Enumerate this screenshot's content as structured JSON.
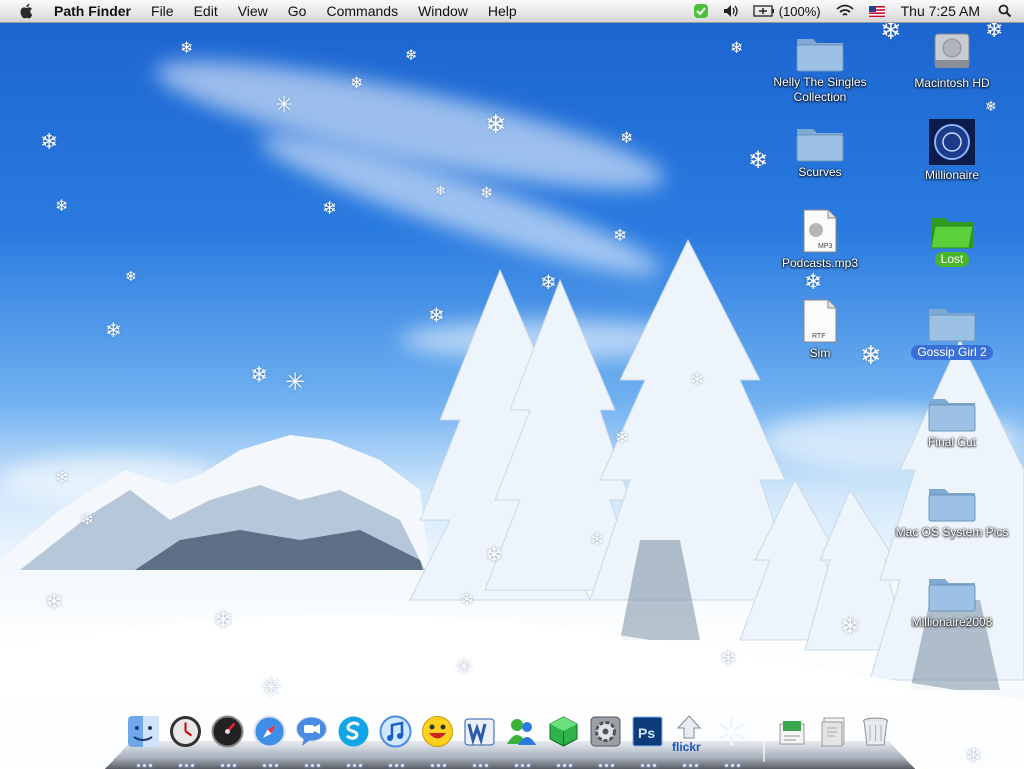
{
  "menubar": {
    "apple_icon": "apple-logo",
    "app_name": "Path Finder",
    "items": [
      "File",
      "Edit",
      "View",
      "Go",
      "Commands",
      "Window",
      "Help"
    ],
    "tray": {
      "battery": "(100%)",
      "clock": "Thu 7:25 AM",
      "icons": [
        "status-check-icon",
        "volume-icon",
        "battery-icon",
        "wifi-icon",
        "us-flag-icon",
        "spotlight-icon"
      ]
    }
  },
  "desktop": {
    "icons": [
      {
        "label": "Nelly The Singles Collection",
        "kind": "folder"
      },
      {
        "label": "Scurves",
        "kind": "folder"
      },
      {
        "label": "Podcasts.mp3",
        "kind": "mp3-file",
        "badge": "MP3"
      },
      {
        "label": "Sim",
        "kind": "rtf-file",
        "badge": "RTF"
      },
      {
        "label": "Macintosh HD",
        "kind": "hard-drive"
      },
      {
        "label": "Millionaire",
        "kind": "app"
      },
      {
        "label": "Lost",
        "kind": "green-folder",
        "state": "selected"
      },
      {
        "label": "Gossip Girl 2",
        "kind": "folder",
        "state": "selected"
      },
      {
        "label": "Final Cut",
        "kind": "folder"
      },
      {
        "label": "Mac OS System Pics",
        "kind": "folder"
      },
      {
        "label": "Millionaire2008",
        "kind": "folder"
      }
    ]
  },
  "dock": {
    "items": [
      {
        "name": "finder",
        "running": true
      },
      {
        "name": "clock",
        "running": true
      },
      {
        "name": "dashboard",
        "running": true
      },
      {
        "name": "safari",
        "running": true
      },
      {
        "name": "ichat",
        "running": true
      },
      {
        "name": "skype",
        "running": true
      },
      {
        "name": "itunes",
        "running": true
      },
      {
        "name": "yahoo-messenger",
        "running": true
      },
      {
        "name": "word",
        "running": true
      },
      {
        "name": "msn-messenger",
        "running": true
      },
      {
        "name": "cube-app",
        "running": true
      },
      {
        "name": "system-preferences",
        "running": true
      },
      {
        "name": "photoshop",
        "running": true
      },
      {
        "name": "flickr-uploader",
        "running": true,
        "label": "flickr"
      },
      {
        "name": "snow-app",
        "running": true
      },
      {
        "name": "documents-stack",
        "running": false
      },
      {
        "name": "downloads-stack",
        "running": false
      },
      {
        "name": "trash",
        "running": false
      }
    ]
  },
  "colors": {
    "sky_top": "#1b63cf",
    "selection_blue": "#3b6fd8",
    "selection_green": "#4bb62c",
    "folder_blue": "#8fb8dd"
  }
}
